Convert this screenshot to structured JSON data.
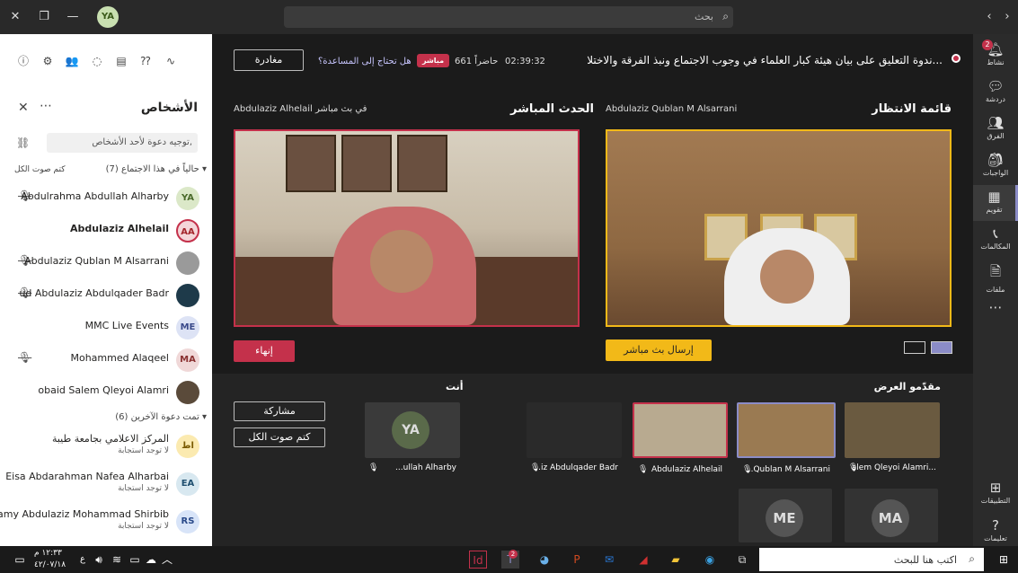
{
  "titlebar": {
    "search_placeholder": "بحث",
    "user_initials": "YA"
  },
  "meeting": {
    "title": "ندوة التعليق على بيان هيئة كبار العلماء في وجوب الاجتماع ونبذ الفرقة والاختلا...",
    "timer": "02:39:32",
    "attendees": "661 حاضراً",
    "live_badge": "مباشر",
    "help_link": "هل تحتاج إلى المساعدة؟",
    "leave_label": "مغادرة"
  },
  "queue": {
    "heading": "قائمة الانتظار",
    "presenter_name": "Abdulaziz Qublan M Alsarrani",
    "send_live_label": "إرسال بث مباشر"
  },
  "live": {
    "heading": "الحدث المباشر",
    "presenter_caption": "Abdulaziz Alhelail في بث مباشر",
    "end_label": "إنهاء"
  },
  "people_panel": {
    "title": "الأشخاص",
    "invite_placeholder": "توجيه دعوة لأحد الأشخاص,",
    "in_meeting_header": "حالياً في هذا الاجتماع (7)",
    "mute_all_link": "كتم صوت الكل",
    "others_header": "تمت دعوة الآخرين (6)",
    "in_meeting": [
      {
        "name": "Abdulrahma Abdullah Alharby",
        "initials": "YA",
        "muted": true,
        "bold": false,
        "color": "#dbe8c8",
        "fg": "#4a6a2a"
      },
      {
        "name": "Abdulaziz Alhelail",
        "initials": "AA",
        "muted": false,
        "bold": true,
        "color": "#f4d6d9",
        "fg": "#a4262c"
      },
      {
        "name": "Abdulaziz Qublan M Alsarrani",
        "initials": "",
        "muted": true,
        "bold": false,
        "color": "#9a9a9a",
        "fg": "#fff"
      },
      {
        "name": "ud Abdulaziz Abdulqader Badr",
        "initials": "",
        "muted": true,
        "bold": false,
        "color": "#1e3a4a",
        "fg": "#fff"
      },
      {
        "name": "MMC Live Events",
        "initials": "ME",
        "muted": false,
        "bold": false,
        "color": "#dde3f5",
        "fg": "#3a4a8a"
      },
      {
        "name": "Mohammed Alaqeel",
        "initials": "MA",
        "muted": true,
        "bold": false,
        "color": "#f0d8d8",
        "fg": "#8a3030"
      },
      {
        "name": "obaid Salem Qleyoi Alamri",
        "initials": "",
        "muted": false,
        "bold": false,
        "color": "#5a4a3a",
        "fg": "#fff"
      }
    ],
    "others": [
      {
        "name": "المركز الاعلامي بجامعة طيبة",
        "status": "لا توجد استجابة",
        "initials": "اط",
        "color": "#fbeab0",
        "fg": "#7a5a00"
      },
      {
        "name": "Eisa Abdarahman Nafea Alharbai",
        "status": "لا توجد استجابة",
        "initials": "EA",
        "color": "#d8e8f0",
        "fg": "#205070"
      },
      {
        "name": "Ramy Abdulaziz Mohammad Shirbib",
        "status": "لا توجد استجابة",
        "initials": "RS",
        "color": "#d8e4f8",
        "fg": "#2a4a8a"
      }
    ]
  },
  "gallery": {
    "presenters_heading": "مقدّمو العرض",
    "you_heading": "أنت",
    "share_label": "مشاركة",
    "mute_all_label": "كتم صوت الكل",
    "tiles": [
      {
        "label": "alem Qleyoi Alamri..."
      },
      {
        "label": "...Qublan M Alsarrani"
      },
      {
        "label": "Abdulaziz Alhelail"
      },
      {
        "label": "...iz Abdulqader Badr"
      },
      {
        "label": "...ullah Alharby"
      }
    ],
    "you_initials": "YA",
    "bottom_tiles": [
      {
        "initials": "ME"
      },
      {
        "initials": "MA"
      }
    ]
  },
  "rail": [
    {
      "icon": "bell-icon",
      "label": "نشاط",
      "badge": "2"
    },
    {
      "icon": "chat-icon",
      "label": "دردشة"
    },
    {
      "icon": "teams-icon",
      "label": "الفرق"
    },
    {
      "icon": "assignments-icon",
      "label": "الواجبات"
    },
    {
      "icon": "calendar-icon",
      "label": "تقويم"
    },
    {
      "icon": "calls-icon",
      "label": "المكالمات"
    },
    {
      "icon": "files-icon",
      "label": "ملفات"
    },
    {
      "icon": "more-icon",
      "label": ""
    }
  ],
  "rail_bottom": [
    {
      "icon": "apps-icon",
      "label": "التطبيقات"
    },
    {
      "icon": "help-icon",
      "label": "تعليمات"
    }
  ],
  "taskbar": {
    "search_placeholder": "اكتب هنا للبحث",
    "time": "١٢:٣٣ م",
    "date": "٤٢/٠٧/١٨",
    "lang": "ع",
    "teams_badge": "2"
  }
}
